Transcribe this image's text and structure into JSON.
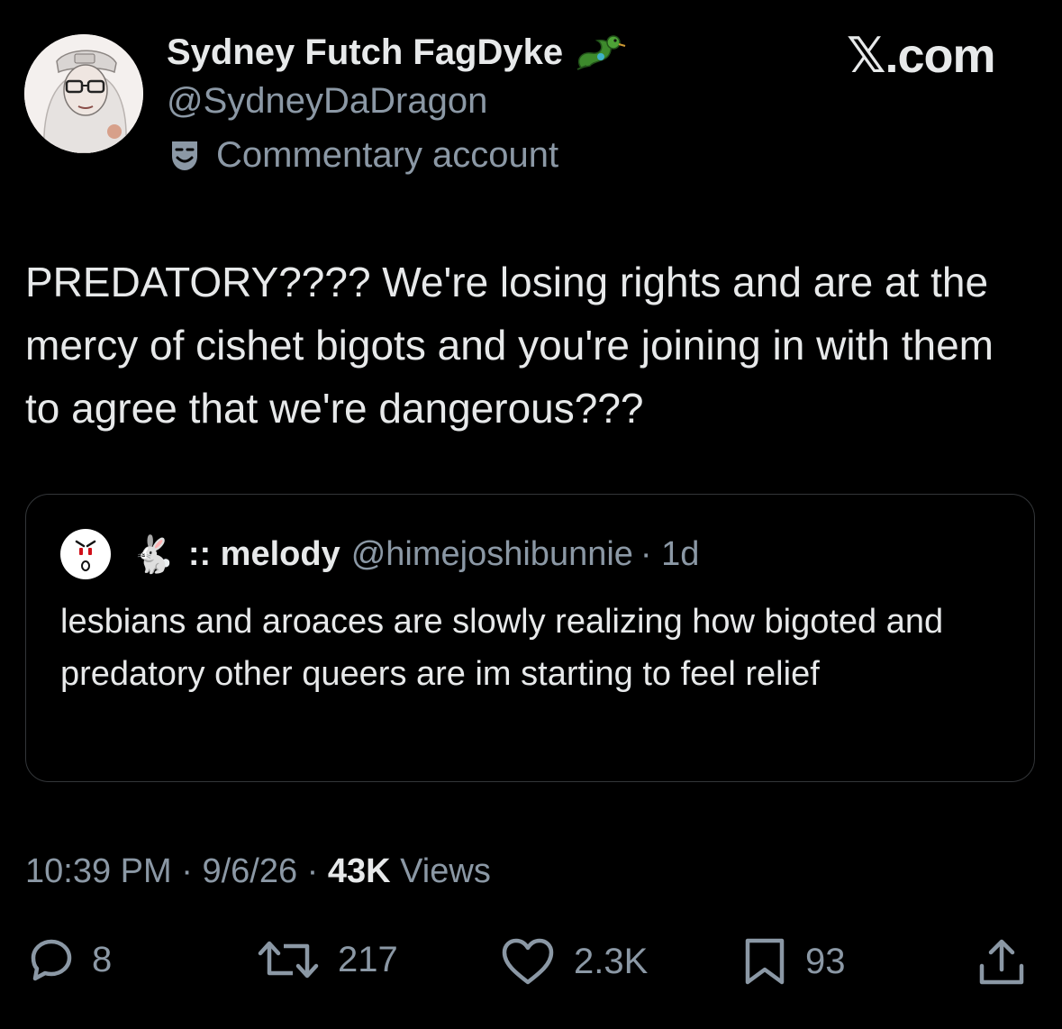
{
  "author": {
    "display_name": "Sydney Futch FagDyke",
    "handle": "@SydneyDaDragon",
    "label": "Commentary account",
    "name_emoji": "dragon-emoji"
  },
  "brand": "𝕏.com",
  "tweet": {
    "text": "PREDATORY???? We're losing rights and are at the mercy of cishet bigots and you're joining in with them to agree that we're dangerous???"
  },
  "quote": {
    "name": ":: melody",
    "handle": "@himejoshibunnie",
    "time": "· 1d",
    "text": "lesbians and aroaces are slowly realizing how bigoted and predatory other queers are im starting to feel relief",
    "bunny_emoji": "🐇"
  },
  "meta": {
    "time": "10:39 PM",
    "sep1": " · ",
    "date": "9/6/26",
    "sep2": " · ",
    "views_count": "43K",
    "views_label": " Views"
  },
  "actions": {
    "replies": "8",
    "reposts": "217",
    "likes": "2.3K",
    "bookmarks": "93"
  },
  "colors": {
    "background": "#000000",
    "primary_text": "#e7e9ea",
    "secondary_text": "#8b98a5",
    "border": "#333639"
  }
}
